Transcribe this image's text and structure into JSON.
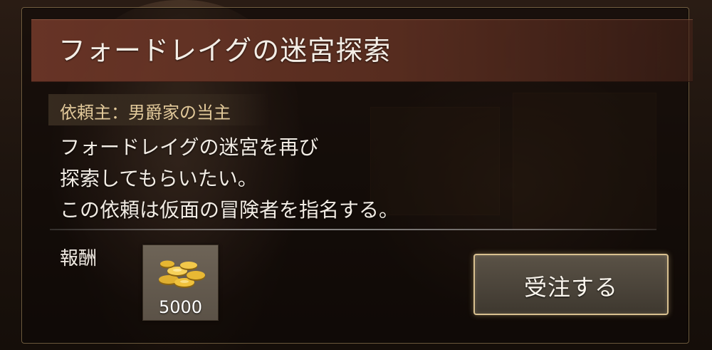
{
  "quest": {
    "title": "フォードレイグの迷宮探索",
    "client_line": "依頼主：男爵家の当主",
    "description_lines": [
      "フォードレイグの迷宮を再び",
      "探索してもらいたい。",
      "この依頼は仮面の冒険者を指名する。"
    ]
  },
  "reward": {
    "label": "報酬",
    "icon": "gold-coins-icon",
    "amount": "5000"
  },
  "actions": {
    "accept_label": "受注する"
  },
  "colors": {
    "title_bar": "#6e3728",
    "client_text": "#e2c99a",
    "button_border": "#d8c090"
  }
}
